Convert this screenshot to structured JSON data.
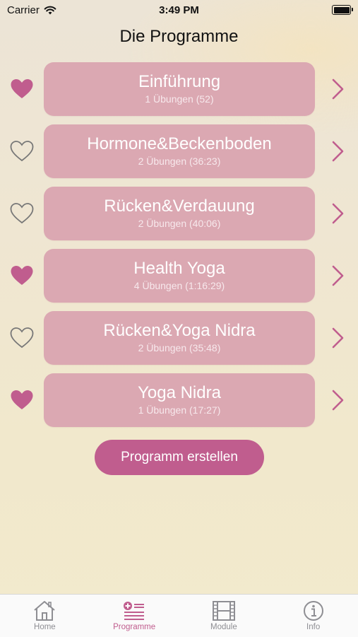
{
  "status_bar": {
    "carrier": "Carrier",
    "time": "3:49 PM"
  },
  "header": {
    "title": "Die Programme"
  },
  "programs": [
    {
      "title": "Einführung",
      "subtitle": "1 Übungen (52)",
      "favorite": true
    },
    {
      "title": "Hormone&Beckenboden",
      "subtitle": "2 Übungen (36:23)",
      "favorite": false
    },
    {
      "title": "Rücken&Verdauung",
      "subtitle": "2 Übungen (40:06)",
      "favorite": false
    },
    {
      "title": "Health Yoga",
      "subtitle": "4 Übungen (1:16:29)",
      "favorite": true
    },
    {
      "title": "Rücken&Yoga Nidra",
      "subtitle": "2 Übungen (35:48)",
      "favorite": false
    },
    {
      "title": "Yoga Nidra",
      "subtitle": "1 Übungen (17:27)",
      "favorite": true
    }
  ],
  "create_button": {
    "label": "Programm erstellen"
  },
  "tab_bar": {
    "tabs": [
      {
        "label": "Home",
        "icon": "home-icon",
        "active": false
      },
      {
        "label": "Programme",
        "icon": "program-list-icon",
        "active": true
      },
      {
        "label": "Module",
        "icon": "film-icon",
        "active": false
      },
      {
        "label": "Info",
        "icon": "info-icon",
        "active": false
      }
    ]
  },
  "colors": {
    "accent": "#c05d8e",
    "card": "#dba8b2",
    "heart_filled": "#c05d8e",
    "heart_outline": "#777777",
    "tab_inactive": "#8e8e93"
  }
}
